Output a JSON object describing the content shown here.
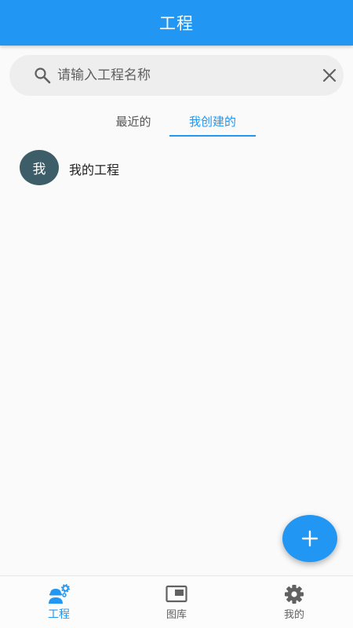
{
  "appbar": {
    "title": "工程"
  },
  "search": {
    "placeholder": "请输入工程名称",
    "value": ""
  },
  "tabs": [
    {
      "label": "最近的",
      "selected": false
    },
    {
      "label": "我创建的",
      "selected": true
    }
  ],
  "projects": [
    {
      "avatar_text": "我",
      "name": "我的工程"
    }
  ],
  "bottom_nav": [
    {
      "label": "工程",
      "icon": "worker-gear-icon",
      "active": true
    },
    {
      "label": "图库",
      "icon": "gallery-icon",
      "active": false
    },
    {
      "label": "我的",
      "icon": "gear-icon",
      "active": false
    }
  ],
  "colors": {
    "primary": "#2196f3",
    "avatar": "#3d5e69",
    "background": "#fafafa"
  }
}
